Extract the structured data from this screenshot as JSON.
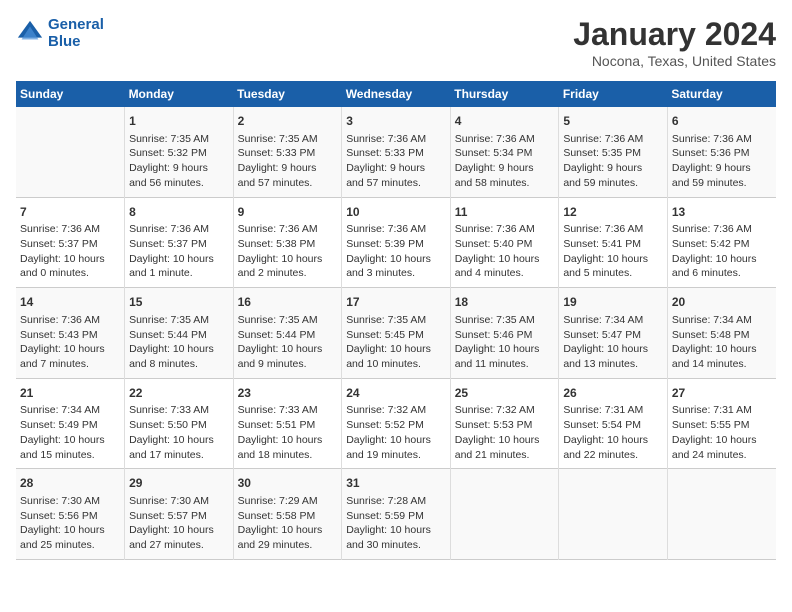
{
  "header": {
    "logo_line1": "General",
    "logo_line2": "Blue",
    "title": "January 2024",
    "subtitle": "Nocona, Texas, United States"
  },
  "columns": [
    "Sunday",
    "Monday",
    "Tuesday",
    "Wednesday",
    "Thursday",
    "Friday",
    "Saturday"
  ],
  "rows": [
    [
      {
        "num": "",
        "info": ""
      },
      {
        "num": "1",
        "info": "Sunrise: 7:35 AM\nSunset: 5:32 PM\nDaylight: 9 hours\nand 56 minutes."
      },
      {
        "num": "2",
        "info": "Sunrise: 7:35 AM\nSunset: 5:33 PM\nDaylight: 9 hours\nand 57 minutes."
      },
      {
        "num": "3",
        "info": "Sunrise: 7:36 AM\nSunset: 5:33 PM\nDaylight: 9 hours\nand 57 minutes."
      },
      {
        "num": "4",
        "info": "Sunrise: 7:36 AM\nSunset: 5:34 PM\nDaylight: 9 hours\nand 58 minutes."
      },
      {
        "num": "5",
        "info": "Sunrise: 7:36 AM\nSunset: 5:35 PM\nDaylight: 9 hours\nand 59 minutes."
      },
      {
        "num": "6",
        "info": "Sunrise: 7:36 AM\nSunset: 5:36 PM\nDaylight: 9 hours\nand 59 minutes."
      }
    ],
    [
      {
        "num": "7",
        "info": "Sunrise: 7:36 AM\nSunset: 5:37 PM\nDaylight: 10 hours\nand 0 minutes."
      },
      {
        "num": "8",
        "info": "Sunrise: 7:36 AM\nSunset: 5:37 PM\nDaylight: 10 hours\nand 1 minute."
      },
      {
        "num": "9",
        "info": "Sunrise: 7:36 AM\nSunset: 5:38 PM\nDaylight: 10 hours\nand 2 minutes."
      },
      {
        "num": "10",
        "info": "Sunrise: 7:36 AM\nSunset: 5:39 PM\nDaylight: 10 hours\nand 3 minutes."
      },
      {
        "num": "11",
        "info": "Sunrise: 7:36 AM\nSunset: 5:40 PM\nDaylight: 10 hours\nand 4 minutes."
      },
      {
        "num": "12",
        "info": "Sunrise: 7:36 AM\nSunset: 5:41 PM\nDaylight: 10 hours\nand 5 minutes."
      },
      {
        "num": "13",
        "info": "Sunrise: 7:36 AM\nSunset: 5:42 PM\nDaylight: 10 hours\nand 6 minutes."
      }
    ],
    [
      {
        "num": "14",
        "info": "Sunrise: 7:36 AM\nSunset: 5:43 PM\nDaylight: 10 hours\nand 7 minutes."
      },
      {
        "num": "15",
        "info": "Sunrise: 7:35 AM\nSunset: 5:44 PM\nDaylight: 10 hours\nand 8 minutes."
      },
      {
        "num": "16",
        "info": "Sunrise: 7:35 AM\nSunset: 5:44 PM\nDaylight: 10 hours\nand 9 minutes."
      },
      {
        "num": "17",
        "info": "Sunrise: 7:35 AM\nSunset: 5:45 PM\nDaylight: 10 hours\nand 10 minutes."
      },
      {
        "num": "18",
        "info": "Sunrise: 7:35 AM\nSunset: 5:46 PM\nDaylight: 10 hours\nand 11 minutes."
      },
      {
        "num": "19",
        "info": "Sunrise: 7:34 AM\nSunset: 5:47 PM\nDaylight: 10 hours\nand 13 minutes."
      },
      {
        "num": "20",
        "info": "Sunrise: 7:34 AM\nSunset: 5:48 PM\nDaylight: 10 hours\nand 14 minutes."
      }
    ],
    [
      {
        "num": "21",
        "info": "Sunrise: 7:34 AM\nSunset: 5:49 PM\nDaylight: 10 hours\nand 15 minutes."
      },
      {
        "num": "22",
        "info": "Sunrise: 7:33 AM\nSunset: 5:50 PM\nDaylight: 10 hours\nand 17 minutes."
      },
      {
        "num": "23",
        "info": "Sunrise: 7:33 AM\nSunset: 5:51 PM\nDaylight: 10 hours\nand 18 minutes."
      },
      {
        "num": "24",
        "info": "Sunrise: 7:32 AM\nSunset: 5:52 PM\nDaylight: 10 hours\nand 19 minutes."
      },
      {
        "num": "25",
        "info": "Sunrise: 7:32 AM\nSunset: 5:53 PM\nDaylight: 10 hours\nand 21 minutes."
      },
      {
        "num": "26",
        "info": "Sunrise: 7:31 AM\nSunset: 5:54 PM\nDaylight: 10 hours\nand 22 minutes."
      },
      {
        "num": "27",
        "info": "Sunrise: 7:31 AM\nSunset: 5:55 PM\nDaylight: 10 hours\nand 24 minutes."
      }
    ],
    [
      {
        "num": "28",
        "info": "Sunrise: 7:30 AM\nSunset: 5:56 PM\nDaylight: 10 hours\nand 25 minutes."
      },
      {
        "num": "29",
        "info": "Sunrise: 7:30 AM\nSunset: 5:57 PM\nDaylight: 10 hours\nand 27 minutes."
      },
      {
        "num": "30",
        "info": "Sunrise: 7:29 AM\nSunset: 5:58 PM\nDaylight: 10 hours\nand 29 minutes."
      },
      {
        "num": "31",
        "info": "Sunrise: 7:28 AM\nSunset: 5:59 PM\nDaylight: 10 hours\nand 30 minutes."
      },
      {
        "num": "",
        "info": ""
      },
      {
        "num": "",
        "info": ""
      },
      {
        "num": "",
        "info": ""
      }
    ]
  ]
}
